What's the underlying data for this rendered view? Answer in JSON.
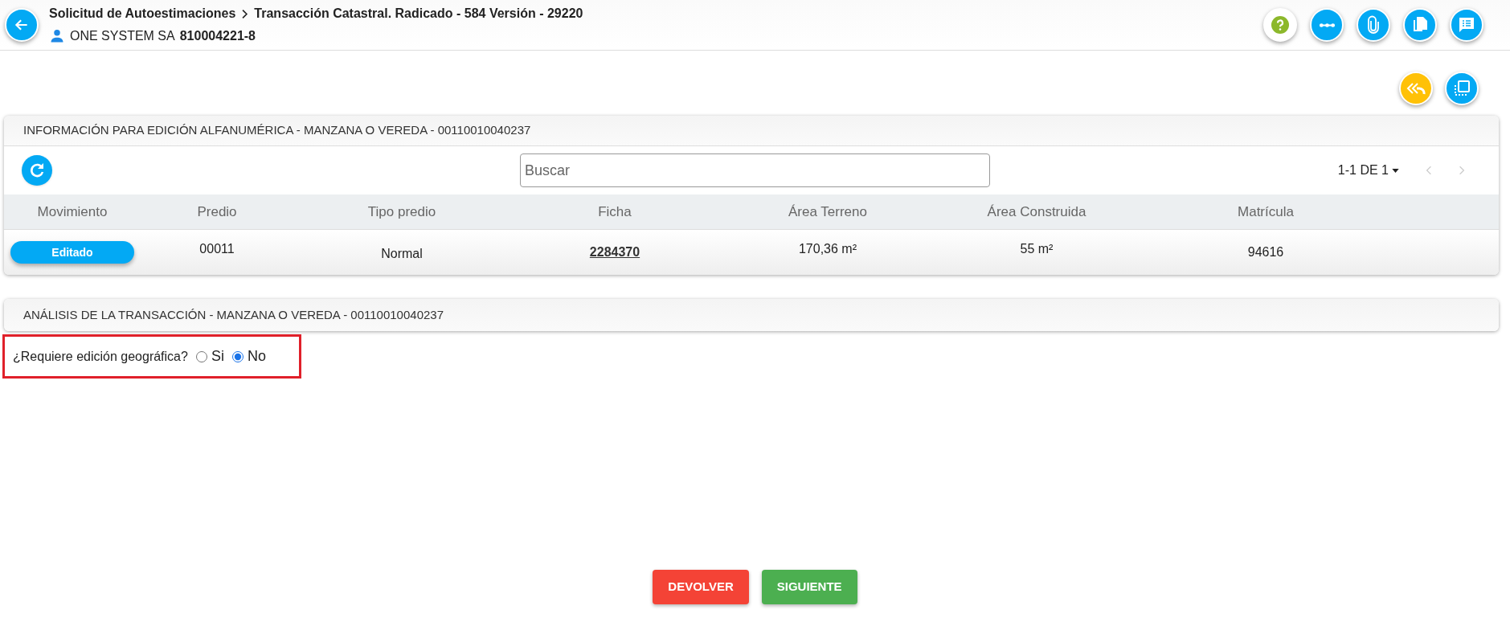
{
  "header": {
    "breadcrumb": [
      "Solicitud de Autoestimaciones",
      "Transacción Catastral. Radicado - 584 Versión - 29220"
    ],
    "user_name": "ONE SYSTEM SA",
    "user_id": "810004221-8"
  },
  "info_panel": {
    "title": "INFORMACIÓN PARA EDICIÓN ALFANUMÉRICA - MANZANA O VEREDA - 00110010040237",
    "search": {
      "placeholder": "Buscar"
    },
    "pagination": "1-1 DE 1",
    "table": {
      "columns": [
        "Movimiento",
        "Predio",
        "Tipo predio",
        "Ficha",
        "Área Terreno",
        "Área Construida",
        "Matrícula"
      ],
      "rows": [
        {
          "movimiento": "Editado",
          "predio": "00011",
          "tipo_predio": "Normal",
          "ficha": "2284370",
          "area_terreno": "170,36 m²",
          "area_construida": "55 m²",
          "matricula": "94616"
        }
      ]
    }
  },
  "analysis_panel": {
    "title": "ANÁLISIS DE LA TRANSACCIÓN - MANZANA O VEREDA - 00110010040237",
    "question": "¿Requiere edición geográfica?",
    "options": [
      {
        "label": "Si",
        "selected": false
      },
      {
        "label": "No",
        "selected": true
      }
    ]
  },
  "buttons": [
    {
      "label": "DEVOLVER",
      "kind": "danger"
    },
    {
      "label": "SIGUIENTE",
      "kind": "success"
    }
  ]
}
